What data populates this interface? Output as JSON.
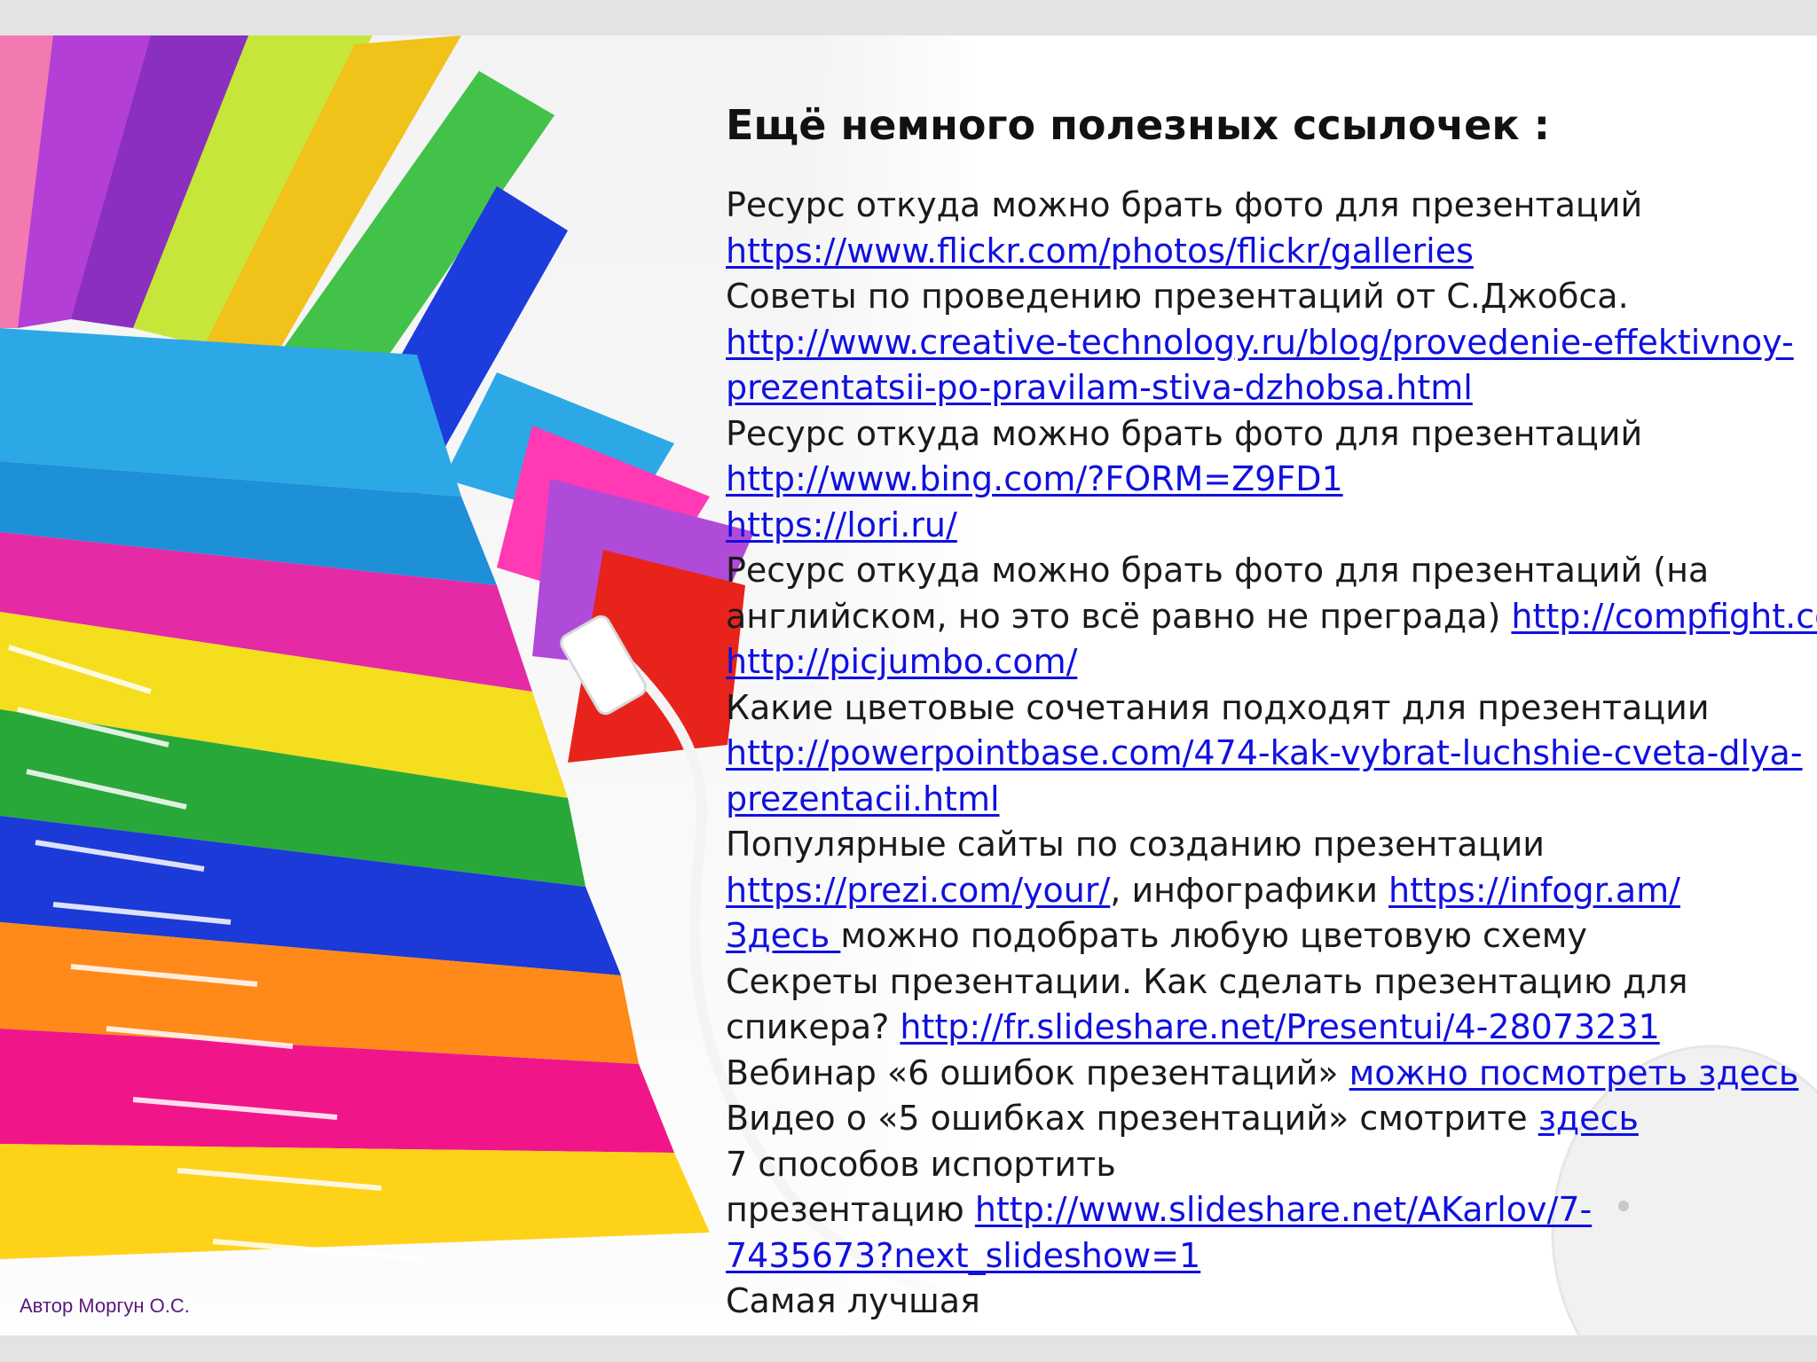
{
  "slide": {
    "title": "Ещё немного полезных ссылочек :",
    "author": "Автор Моргун О.С.",
    "lines": [
      [
        {
          "t": "Ресурс откуда можно брать фото для презентаций"
        }
      ],
      [
        {
          "t": "https://www.flickr.com/photos/flickr/galleries",
          "link": true
        }
      ],
      [
        {
          "t": "Советы по проведению презентаций от С.Джобса."
        }
      ],
      [
        {
          "t": "http://www.creative-technology.ru/blog/provedenie-effektivnoy-",
          "link": true
        }
      ],
      [
        {
          "t": "prezentatsii-po-pravilam-stiva-dzhobsa.html",
          "link": true
        }
      ],
      [
        {
          "t": "Ресурс откуда можно брать фото для презентаций"
        }
      ],
      [
        {
          "t": "http://www.bing.com/?FORM=Z9FD1",
          "link": true
        }
      ],
      [
        {
          "t": "https://lori.ru/",
          "link": true
        }
      ],
      [
        {
          "t": "Ресурс откуда можно брать фото для презентаций  (на"
        }
      ],
      [
        {
          "t": "английском, но это всё равно не преграда) "
        },
        {
          "t": "http://compfight.com/",
          "link": true
        }
      ],
      [
        {
          "t": "http://picjumbo.com/",
          "link": true
        }
      ],
      [
        {
          "t": "Какие цветовые сочетания подходят для презентации"
        }
      ],
      [
        {
          "t": "http://powerpointbase.com/474-kak-vybrat-luchshie-cveta-dlya-",
          "link": true
        }
      ],
      [
        {
          "t": "prezentacii.html",
          "link": true
        }
      ],
      [
        {
          "t": "Популярные сайты по созданию презентации"
        }
      ],
      [
        {
          "t": "https://prezi.com/your/",
          "link": true
        },
        {
          "t": ", инфографики "
        },
        {
          "t": "https://infogr.am/",
          "link": true
        }
      ],
      [
        {
          "t": "Здесь ",
          "link": true
        },
        {
          "t": "можно подобрать любую цветовую схему"
        }
      ],
      [
        {
          "t": "Секреты презентации. Как сделать презентацию для"
        }
      ],
      [
        {
          "t": "спикера? "
        },
        {
          "t": "http://fr.slideshare.net/Presentui/4-28073231",
          "link": true
        }
      ],
      [
        {
          "t": "Вебинар «6 ошибок презентаций» "
        },
        {
          "t": "можно посмотреть здесь",
          "link": true
        }
      ],
      [
        {
          "t": "Видео о «5 ошибках презентаций» смотрите "
        },
        {
          "t": "здесь",
          "link": true
        }
      ],
      [
        {
          "t": "7 способов испортить"
        }
      ],
      [
        {
          "t": "презентацию  "
        },
        {
          "t": "http://www.slideshare.net/AKarlov/7-",
          "link": true
        }
      ],
      [
        {
          "t": "7435673?next_slideshow=1",
          "link": true
        }
      ],
      [
        {
          "t": "Самая лучшая"
        }
      ]
    ]
  },
  "colors": {
    "link": "#1010e0",
    "text": "#1a1a1a",
    "author": "#5a1a7a",
    "frame": "#e3e3e3"
  },
  "art": {
    "description_icon": "books-stack-illustration"
  }
}
